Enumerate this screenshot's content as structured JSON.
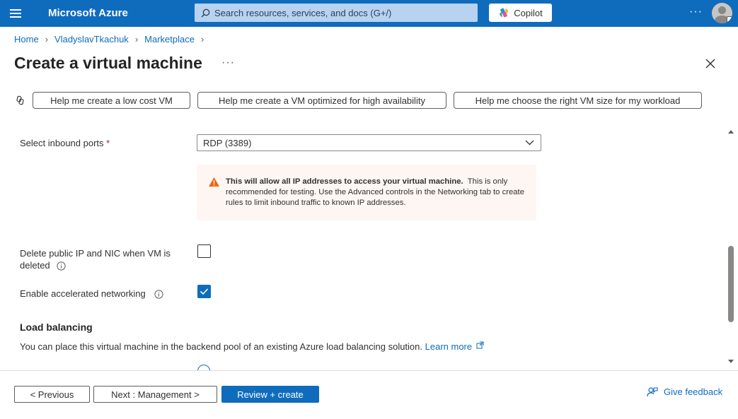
{
  "topbar": {
    "brand": "Microsoft Azure",
    "search_placeholder": "Search resources, services, and docs (G+/)",
    "copilot_label": "Copilot",
    "more_label": "···"
  },
  "breadcrumb": [
    "Home",
    "VladyslavTkachuk",
    "Marketplace"
  ],
  "page": {
    "title": "Create a virtual machine",
    "more_label": "···"
  },
  "helpers": [
    "Help me create a low cost VM",
    "Help me create a VM optimized for high availability",
    "Help me choose the right VM size for my workload"
  ],
  "form": {
    "inbound_ports_label": "Select inbound ports",
    "required_marker": "*",
    "inbound_ports_value": "RDP (3389)",
    "warning_bold": "This will allow all IP addresses to access your virtual machine.",
    "warning_text": "This is only recommended for testing.  Use the Advanced controls in the Networking tab to create rules to limit inbound traffic to known IP addresses.",
    "delete_ip_label": "Delete public IP and NIC when VM is deleted",
    "delete_ip_checked": false,
    "accel_net_label": "Enable accelerated networking",
    "accel_net_checked": true,
    "lb_title": "Load balancing",
    "lb_desc": "You can place this virtual machine in the backend pool of an existing Azure load balancing solution.",
    "lb_learn_more": "Learn more"
  },
  "footer": {
    "previous": "< Previous",
    "next": "Next : Management >",
    "review": "Review + create",
    "feedback": "Give feedback"
  },
  "colors": {
    "accent": "#0f6cbd",
    "warning_bg": "#fdf6f3",
    "warning_icon": "#f7630c"
  }
}
